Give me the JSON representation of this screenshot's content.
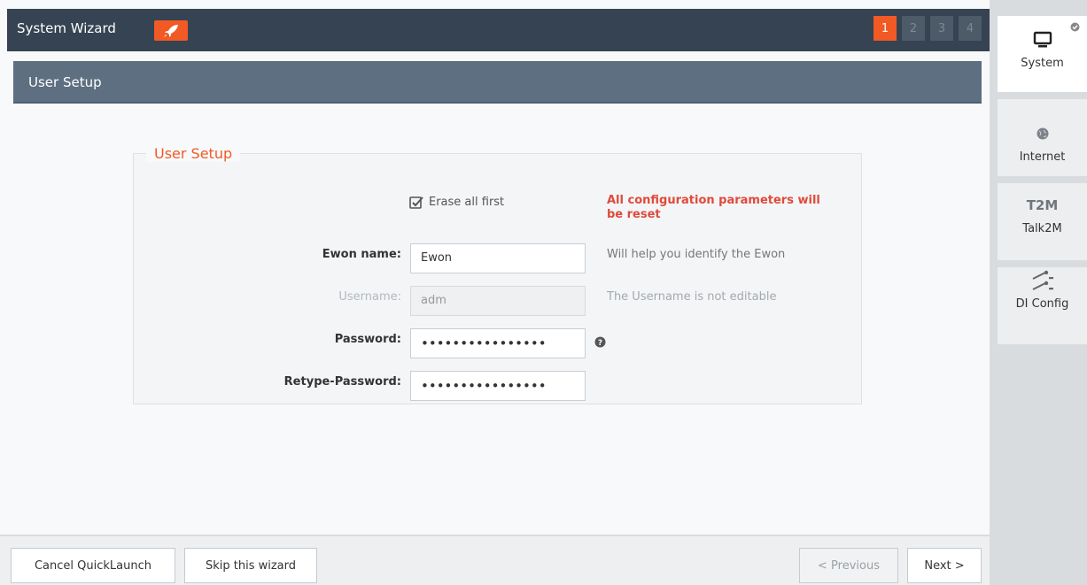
{
  "wizard": {
    "title": "System Wizard",
    "steps": [
      "1",
      "2",
      "3",
      "4"
    ],
    "active_step": 1,
    "accent_color": "#f15a24"
  },
  "section": {
    "title": "User Setup"
  },
  "form": {
    "legend": "User Setup",
    "erase_label": "Erase all first",
    "erase_checked": true,
    "warning": "All configuration parameters will be reset",
    "fields": {
      "ewon_name": {
        "label": "Ewon name:",
        "value": "Ewon",
        "hint": "Will help you identify the Ewon"
      },
      "username": {
        "label": "Username:",
        "value": "adm",
        "hint": "The Username is not editable"
      },
      "password": {
        "label": "Password:",
        "value": "••••••••••••••••"
      },
      "retype_password": {
        "label": "Retype-Password:",
        "value": "••••••••••••••••"
      }
    }
  },
  "footer": {
    "cancel": "Cancel QuickLaunch",
    "skip": "Skip this wizard",
    "previous": "< Previous",
    "next": "Next >"
  },
  "sidebar": {
    "items": [
      {
        "label": "System",
        "icon": "monitor-icon",
        "active": true
      },
      {
        "label": "Internet",
        "icon": "globe-icon"
      },
      {
        "label": "Talk2M",
        "icon": "t2m-icon",
        "icon_text": "T2M"
      },
      {
        "label": "DI Config",
        "icon": "switch-icon"
      }
    ]
  }
}
